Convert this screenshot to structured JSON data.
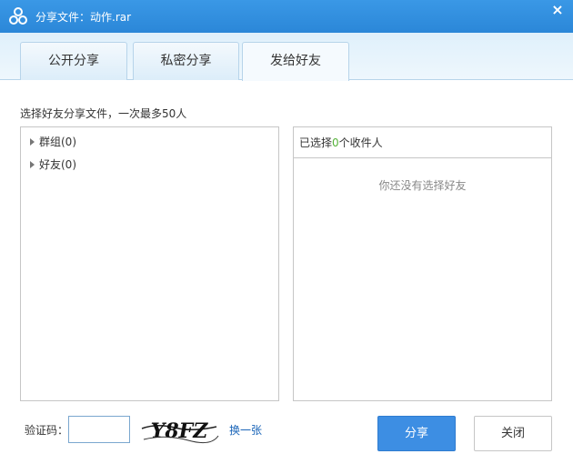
{
  "window": {
    "title": "分享文件：动作.rar",
    "close_glyph": "×"
  },
  "tabs": [
    {
      "label": "公开分享",
      "active": false
    },
    {
      "label": "私密分享",
      "active": false
    },
    {
      "label": "发给好友",
      "active": true
    }
  ],
  "hint": "选择好友分享文件，一次最多50人",
  "tree": {
    "items": [
      {
        "label": "群组(0)"
      },
      {
        "label": "好友(0)"
      }
    ]
  },
  "selected": {
    "prefix": "已选择",
    "count": "0",
    "suffix": "个收件人",
    "empty_text": "你还没有选择好友"
  },
  "captcha": {
    "label": "验证码：",
    "value": "",
    "image_text": "Y8FZ",
    "change_label": "换一张"
  },
  "buttons": {
    "share": "分享",
    "close": "关闭"
  },
  "colors": {
    "titlebar": "#2b87d8",
    "accent": "#3d8ee3",
    "count_green": "#55b23a",
    "link": "#1a65b8"
  }
}
